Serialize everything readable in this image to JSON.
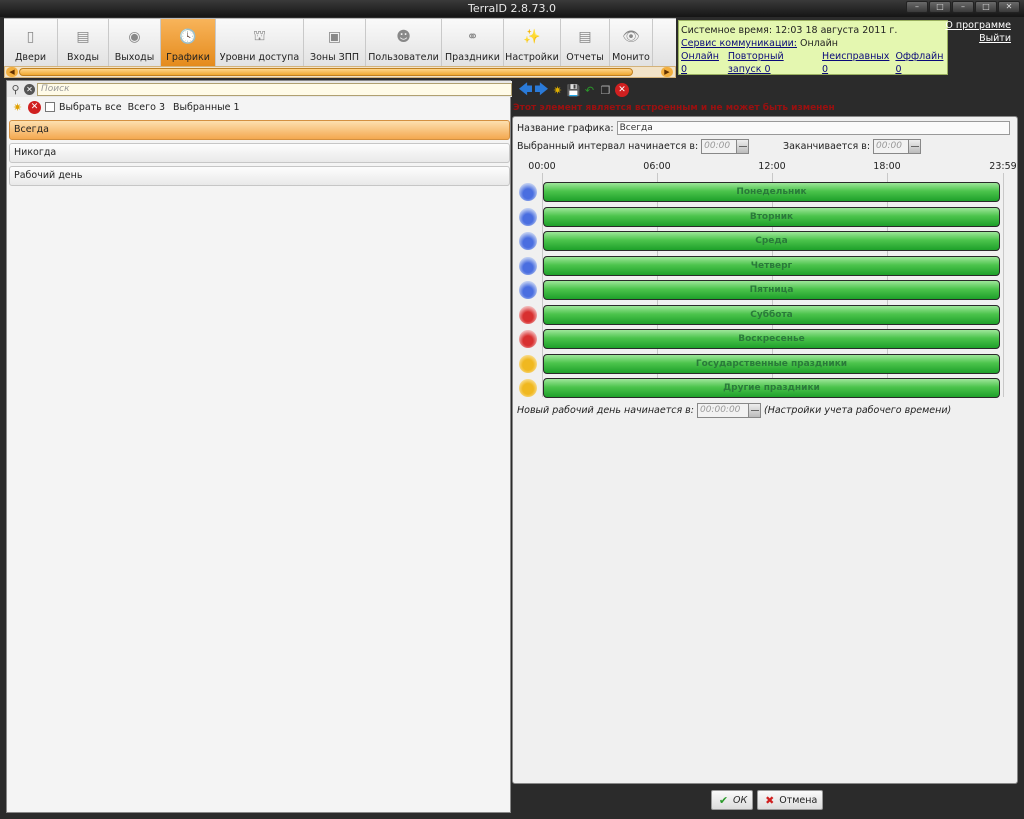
{
  "window": {
    "title": "TerraID 2.8.73.0"
  },
  "toolbar": {
    "items": [
      {
        "label": "Двери",
        "icon": "door-icon"
      },
      {
        "label": "Входы",
        "icon": "entry-icon"
      },
      {
        "label": "Выходы",
        "icon": "exit-icon"
      },
      {
        "label": "Графики",
        "icon": "clock-icon",
        "active": true
      },
      {
        "label": "Уровни доступа",
        "icon": "access-levels-icon"
      },
      {
        "label": "Зоны ЗПП",
        "icon": "zones-icon"
      },
      {
        "label": "Пользователи",
        "icon": "users-icon"
      },
      {
        "label": "Праздники",
        "icon": "balloons-icon"
      },
      {
        "label": "Настройки",
        "icon": "tools-icon"
      },
      {
        "label": "Отчеты",
        "icon": "reports-icon"
      },
      {
        "label": "Монито",
        "icon": "eye-icon"
      }
    ]
  },
  "status": {
    "system_time_label": "Системное время:",
    "system_time": "12:03 18 августа 2011 г.",
    "comm_link": "Сервис коммуникации:",
    "comm_value": "Онлайн",
    "online": "Онлайн 0",
    "retry": "Повторный запуск 0",
    "faulty": "Неисправных 0",
    "offline": "Оффлайн 0"
  },
  "links": {
    "about": "О программе",
    "exit": "Выйти"
  },
  "search": {
    "placeholder": "Поиск"
  },
  "listtools": {
    "select_all": "Выбрать все",
    "total": "Всего 3",
    "selected": "Выбранные 1"
  },
  "list": [
    "Всегда",
    "Никогда",
    "Рабочий день"
  ],
  "detail": {
    "warning": "Этот элемент является встроенным и не может быть изменен",
    "name_label": "Название графика:",
    "name_value": "Всегда",
    "start_label": "Выбранный интервал начинается в:",
    "start_value": "00:00",
    "end_label": "Заканчивается в:",
    "end_value": "00:00",
    "ticks": [
      "00:00",
      "06:00",
      "12:00",
      "18:00",
      "23:59"
    ],
    "days": [
      {
        "name": "Понедельник",
        "color": "blue"
      },
      {
        "name": "Вторник",
        "color": "blue"
      },
      {
        "name": "Среда",
        "color": "blue"
      },
      {
        "name": "Четверг",
        "color": "blue"
      },
      {
        "name": "Пятница",
        "color": "blue"
      },
      {
        "name": "Суббота",
        "color": "red"
      },
      {
        "name": "Воскресенье",
        "color": "red"
      },
      {
        "name": "Государственные праздники",
        "color": "yellow"
      },
      {
        "name": "Другие праздники",
        "color": "yellow"
      }
    ],
    "newday_label": "Новый рабочий день начинается в:",
    "newday_value": "00:00:00",
    "worktime_note": "(Настройки учета рабочего времени)"
  },
  "buttons": {
    "ok": "ОК",
    "cancel": "Отмена"
  }
}
